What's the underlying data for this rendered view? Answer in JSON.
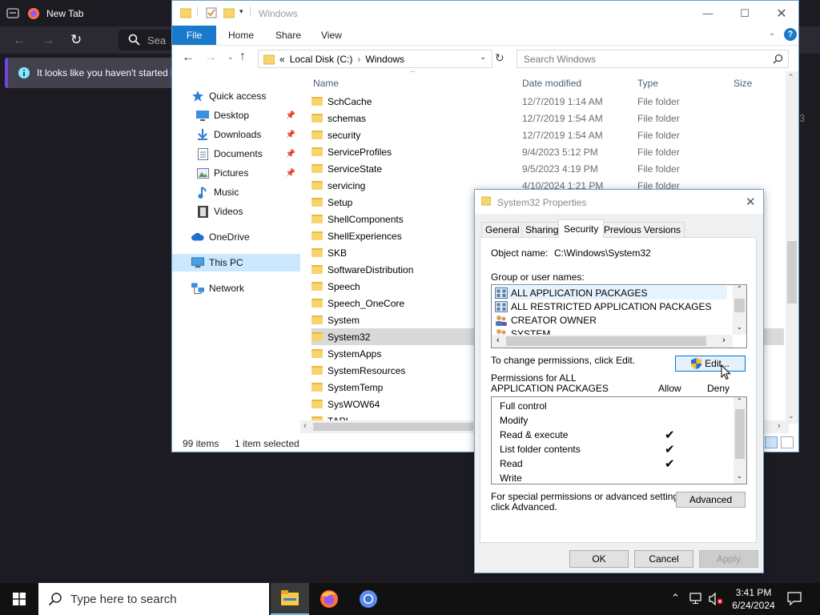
{
  "firefox": {
    "tab_title": "New Tab",
    "search_placeholder": "Sea",
    "notice_text": "It looks like you haven't started l"
  },
  "explorer": {
    "title": "Windows",
    "ribbon_tabs": [
      "File",
      "Home",
      "Share",
      "View"
    ],
    "address": {
      "prefix": "«",
      "parts": [
        "Local Disk (C:)",
        "Windows"
      ]
    },
    "search_placeholder": "Search Windows",
    "nav": [
      {
        "label": "Quick access",
        "icon": "star-icon"
      },
      {
        "label": "Desktop",
        "icon": "desktop-icon",
        "pinned": true
      },
      {
        "label": "Downloads",
        "icon": "download-icon",
        "pinned": true
      },
      {
        "label": "Documents",
        "icon": "documents-icon",
        "pinned": true
      },
      {
        "label": "Pictures",
        "icon": "pictures-icon",
        "pinned": true
      },
      {
        "label": "Music",
        "icon": "music-icon"
      },
      {
        "label": "Videos",
        "icon": "videos-icon"
      },
      {
        "label": "OneDrive",
        "icon": "cloud-icon"
      },
      {
        "label": "This PC",
        "icon": "computer-icon",
        "selected": true
      },
      {
        "label": "Network",
        "icon": "network-icon"
      }
    ],
    "columns": {
      "name": "Name",
      "date": "Date modified",
      "type": "Type",
      "size": "Size"
    },
    "rows": [
      {
        "name": "SchCache",
        "date": "12/7/2019 1:14 AM",
        "type": "File folder"
      },
      {
        "name": "schemas",
        "date": "12/7/2019 1:54 AM",
        "type": "File folder"
      },
      {
        "name": "security",
        "date": "12/7/2019 1:54 AM",
        "type": "File folder"
      },
      {
        "name": "ServiceProfiles",
        "date": "9/4/2023 5:12 PM",
        "type": "File folder"
      },
      {
        "name": "ServiceState",
        "date": "9/5/2023 4:19 PM",
        "type": "File folder"
      },
      {
        "name": "servicing",
        "date": "4/10/2024 1:21 PM",
        "type": "File folder"
      },
      {
        "name": "Setup",
        "date": "",
        "type": ""
      },
      {
        "name": "ShellComponents",
        "date": "",
        "type": ""
      },
      {
        "name": "ShellExperiences",
        "date": "",
        "type": ""
      },
      {
        "name": "SKB",
        "date": "",
        "type": ""
      },
      {
        "name": "SoftwareDistribution",
        "date": "",
        "type": ""
      },
      {
        "name": "Speech",
        "date": "",
        "type": ""
      },
      {
        "name": "Speech_OneCore",
        "date": "",
        "type": ""
      },
      {
        "name": "System",
        "date": "",
        "type": ""
      },
      {
        "name": "System32",
        "date": "",
        "type": "",
        "selected": true
      },
      {
        "name": "SystemApps",
        "date": "",
        "type": ""
      },
      {
        "name": "SystemResources",
        "date": "",
        "type": ""
      },
      {
        "name": "SystemTemp",
        "date": "",
        "type": ""
      },
      {
        "name": "SysWOW64",
        "date": "",
        "type": ""
      },
      {
        "name": "TAPI",
        "date": "",
        "type": ""
      }
    ],
    "status": {
      "count": "99 items",
      "selection": "1 item selected"
    }
  },
  "dialog": {
    "title": "System32 Properties",
    "tabs": [
      "General",
      "Sharing",
      "Security",
      "Previous Versions"
    ],
    "active_tab": "Security",
    "object_label": "Object name:",
    "object_value": "C:\\Windows\\System32",
    "group_label": "Group or user names:",
    "groups": [
      {
        "name": "ALL APPLICATION PACKAGES",
        "selected": true
      },
      {
        "name": "ALL RESTRICTED APPLICATION PACKAGES"
      },
      {
        "name": "CREATOR OWNER"
      },
      {
        "name": "SYSTEM"
      }
    ],
    "change_text": "To change permissions, click Edit.",
    "edit_label": "Edit...",
    "perm_label_line1": "Permissions for ALL",
    "perm_label_line2": "APPLICATION PACKAGES",
    "allow_label": "Allow",
    "deny_label": "Deny",
    "permissions": [
      {
        "name": "Full control",
        "allow": false,
        "deny": false
      },
      {
        "name": "Modify",
        "allow": false,
        "deny": false
      },
      {
        "name": "Read & execute",
        "allow": true,
        "deny": false
      },
      {
        "name": "List folder contents",
        "allow": true,
        "deny": false
      },
      {
        "name": "Read",
        "allow": true,
        "deny": false
      },
      {
        "name": "Write",
        "allow": false,
        "deny": false
      }
    ],
    "advanced_text_line1": "For special permissions or advanced settings,",
    "advanced_text_line2": "click Advanced.",
    "advanced_label": "Advanced",
    "ok_label": "OK",
    "cancel_label": "Cancel",
    "apply_label": "Apply"
  },
  "taskbar": {
    "search_placeholder": "Type here to search",
    "time": "3:41 PM",
    "date": "6/24/2024"
  },
  "colors": {
    "accent": "#1979ca",
    "taskbar": "#111111",
    "firefox_bg": "#1c1b22"
  }
}
